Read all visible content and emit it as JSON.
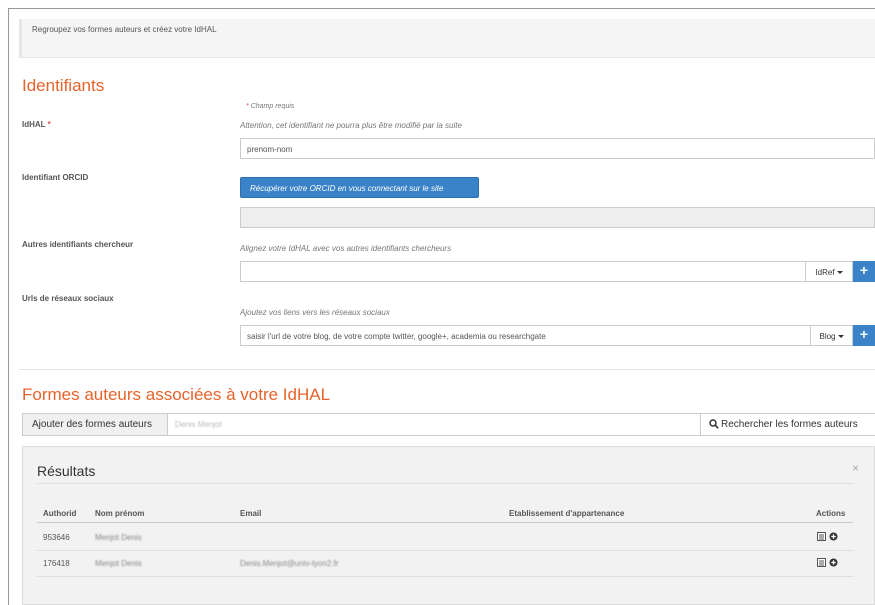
{
  "intro": {
    "text": "Regroupez vos formes auteurs et créez votre IdHAL"
  },
  "identifiants": {
    "title": "Identifiants",
    "required_note": "Champ requis",
    "idhal": {
      "label": "IdHAL",
      "star": "*",
      "help": "Attention, cet identifiant ne pourra plus être modifié par la suite",
      "value": "prenom-nom"
    },
    "orcid": {
      "label": "Identifiant ORCID",
      "button": "Récupérer votre ORCID en vous connectant sur le site",
      "value": ""
    },
    "autres": {
      "label": "Autres identifiants chercheur",
      "help": "Alignez votre IdHAL avec vos autres identifiants chercheurs",
      "value": "",
      "addon": "IdRef",
      "plus": "+"
    },
    "urls": {
      "label": "Urls de réseaux sociaux",
      "help": "Ajoutez vos liens vers les réseaux sociaux",
      "placeholder": "saisir l'url de votre blog, de votre compte twitter, google+, academia ou researchgate",
      "addon": "Blog",
      "plus": "+"
    }
  },
  "formes": {
    "title": "Formes auteurs associées à votre IdHAL",
    "add_label": "Ajouter des formes auteurs",
    "search_value": "Denis Menjot",
    "search_button": "Rechercher les formes auteurs"
  },
  "results": {
    "title": "Résultats",
    "close": "×",
    "headers": {
      "authorid": "Authorid",
      "nom": "Nom prénom",
      "email": "Email",
      "etab": "Etablissement d'appartenance",
      "actions": "Actions"
    },
    "rows": [
      {
        "authorid": "953646",
        "nom": "Menjot Denis",
        "email": ""
      },
      {
        "authorid": "176418",
        "nom": "Menjot Denis",
        "email": "Denis.Menjot@univ-lyon2.fr"
      }
    ]
  },
  "colors": {
    "accent": "#e8632b",
    "primary": "#3a83c9",
    "required": "#d9534f"
  }
}
